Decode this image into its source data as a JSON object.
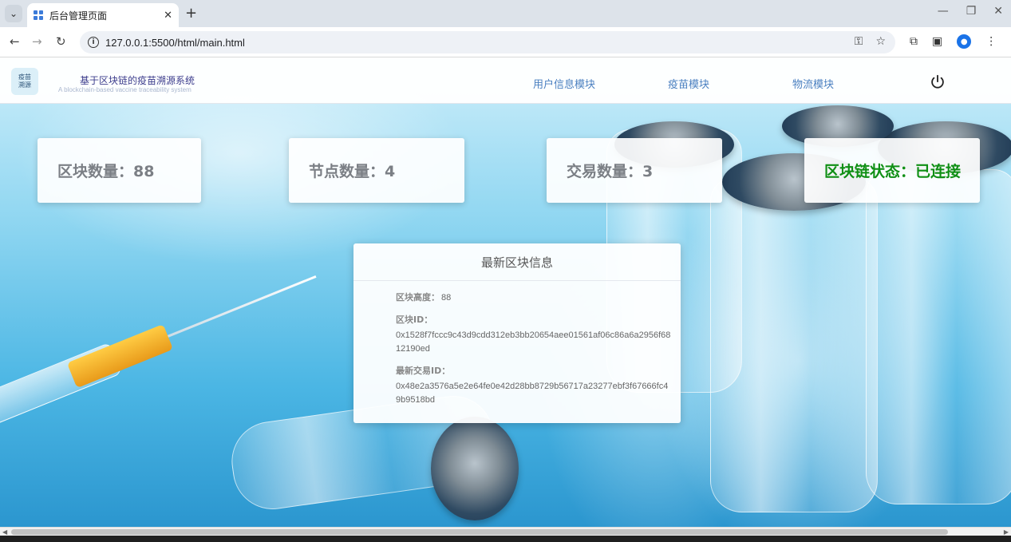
{
  "browser": {
    "tab_title": "后台管理页面",
    "url": "127.0.0.1:5500/html/main.html"
  },
  "header": {
    "logo_line1": "疫苗",
    "logo_line2": "溯源",
    "title": "基于区块链的疫苗溯源系统",
    "subtitle": "A blockchain-based vaccine traceability system",
    "nav": [
      "用户信息模块",
      "疫苗模块",
      "物流模块"
    ]
  },
  "stats": {
    "block_count": "区块数量：88",
    "node_count": "节点数量：4",
    "tx_count": "交易数量：3",
    "chain_status": "区块链状态：已连接",
    "status_color": "#0f8f14"
  },
  "latest_block": {
    "title": "最新区块信息",
    "height_label": "区块高度：",
    "height_value": "88",
    "id_label": "区块ID：",
    "id_value": "0x1528f7fccc9c43d9cdd312eb3bb20654aee01561af06c86a6a2956f6812190ed",
    "tx_label": "最新交易ID：",
    "tx_value": "0x48e2a3576a5e2e64fe0e42d28bb8729b56717a23277ebf3f67666fc49b9518bd"
  }
}
